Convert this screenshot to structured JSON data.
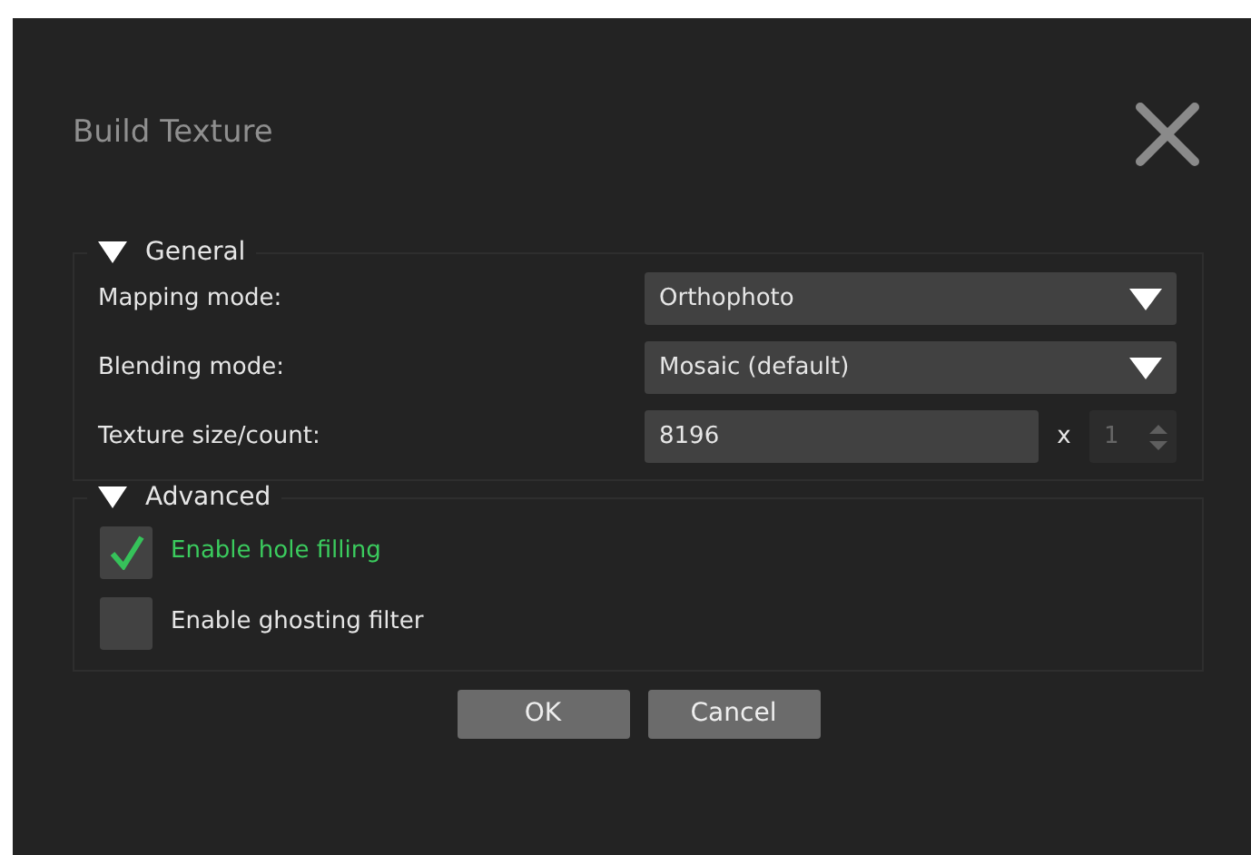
{
  "window": {
    "title": "Build Texture"
  },
  "sections": [
    {
      "title": "General",
      "expanded": true,
      "rows": [
        {
          "kind": "combo",
          "label": "Mapping mode:",
          "value": "Orthophoto"
        },
        {
          "kind": "combo",
          "label": "Blending mode:",
          "value": "Mosaic (default)"
        },
        {
          "kind": "size",
          "label": "Texture size/count:",
          "value": "8196",
          "separator": "x",
          "count": "1",
          "count_disabled": true
        }
      ]
    },
    {
      "title": "Advanced",
      "expanded": true,
      "rows": [
        {
          "kind": "checkbox",
          "label": "Enable hole filling",
          "checked": true
        },
        {
          "kind": "checkbox",
          "label": "Enable ghosting filter",
          "checked": false
        }
      ]
    }
  ],
  "buttons": [
    "OK",
    "Cancel"
  ]
}
